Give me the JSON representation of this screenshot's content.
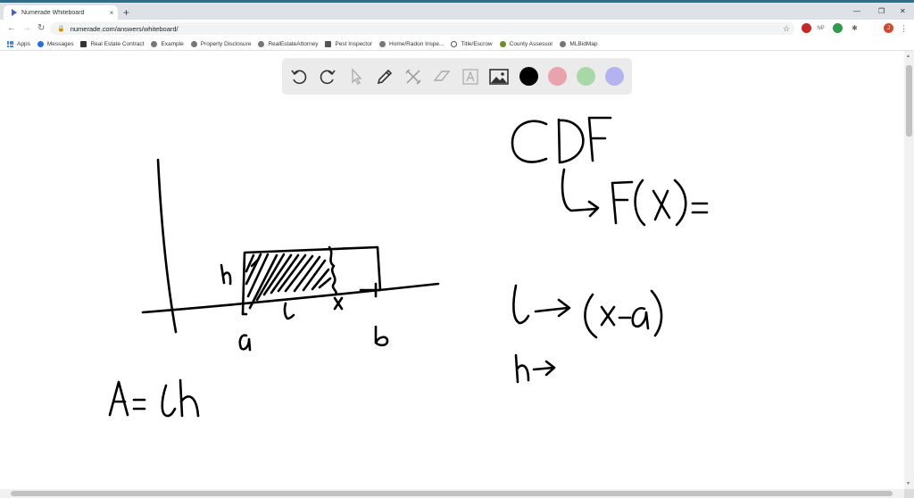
{
  "browser": {
    "tab_title": "Numerade Whiteboard",
    "tab_close": "×",
    "new_tab": "+",
    "url": "numerade.com/answers/whiteboard/",
    "window_controls": {
      "minimize": "—",
      "maximize": "❐",
      "close": "✕"
    },
    "extensions": [
      "red-record-icon",
      "NP",
      "green-drop-icon",
      "puzzle-icon"
    ],
    "profile_initial": "J",
    "bookmarks": [
      {
        "label": "Apps",
        "icon": "apps-grid-icon"
      },
      {
        "label": "Messages",
        "icon": "messages-icon"
      },
      {
        "label": "Real Estate Contract",
        "icon": "doc-icon"
      },
      {
        "label": "Example",
        "icon": "globe-icon"
      },
      {
        "label": "Property Disclosure",
        "icon": "globe-icon"
      },
      {
        "label": "RealEstateAttorney",
        "icon": "globe-icon"
      },
      {
        "label": "Pest Inspector",
        "icon": "pest-icon"
      },
      {
        "label": "Home/Radon Inspe...",
        "icon": "globe-icon"
      },
      {
        "label": "Title/Escrow",
        "icon": "title-icon"
      },
      {
        "label": "County Assessor",
        "icon": "county-icon"
      },
      {
        "label": "MLBidMap",
        "icon": "globe-icon"
      }
    ]
  },
  "whiteboard": {
    "tools": [
      "undo-icon",
      "redo-icon",
      "pointer-icon",
      "pen-icon",
      "tools-icon",
      "eraser-icon",
      "text-icon",
      "image-icon"
    ],
    "colors": [
      "#000000",
      "#e8a3ac",
      "#a8d8a8",
      "#b3b3f0"
    ],
    "selected_color": "#000000"
  }
}
